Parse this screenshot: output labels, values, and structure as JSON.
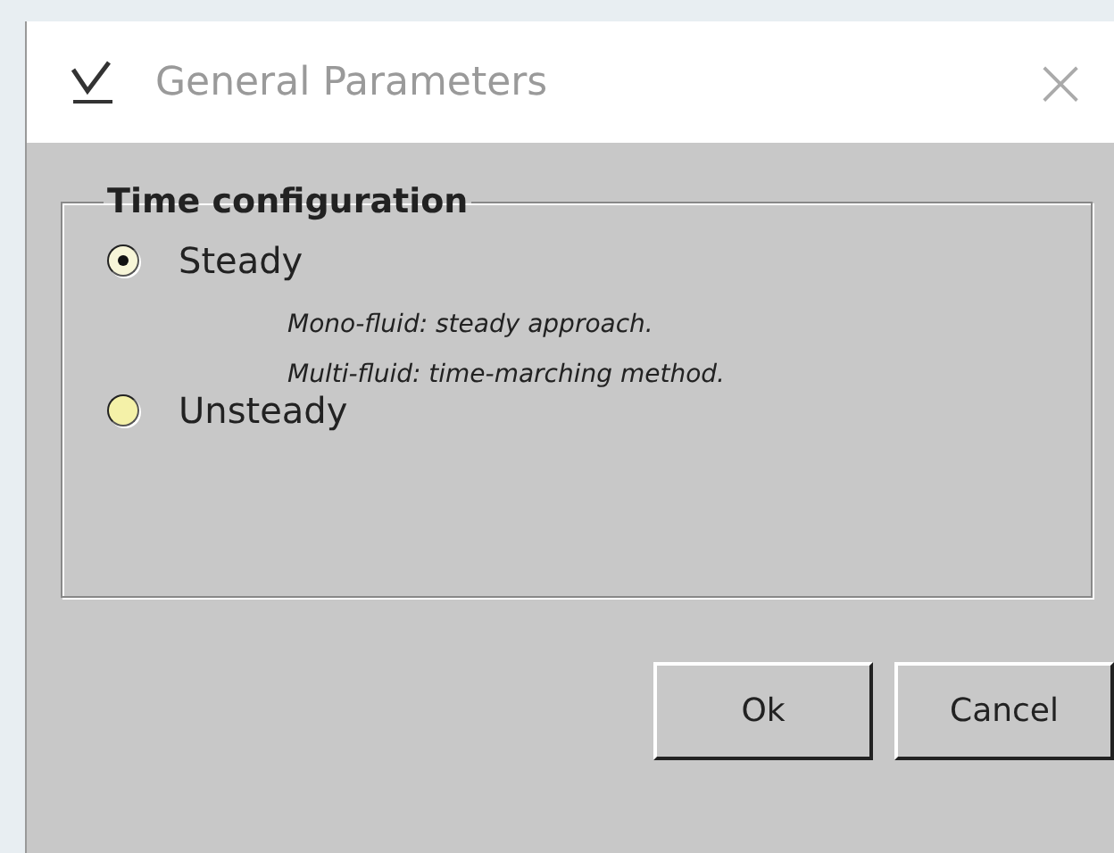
{
  "window": {
    "title": "General Parameters",
    "close": "×"
  },
  "group": {
    "legend": "Time configuration",
    "options": [
      {
        "label": "Steady",
        "selected": true,
        "notes": [
          "Mono-fluid: steady approach.",
          "Multi-fluid: time-marching method."
        ]
      },
      {
        "label": "Unsteady",
        "selected": false
      }
    ]
  },
  "buttons": [
    "Ok",
    "Cancel"
  ]
}
